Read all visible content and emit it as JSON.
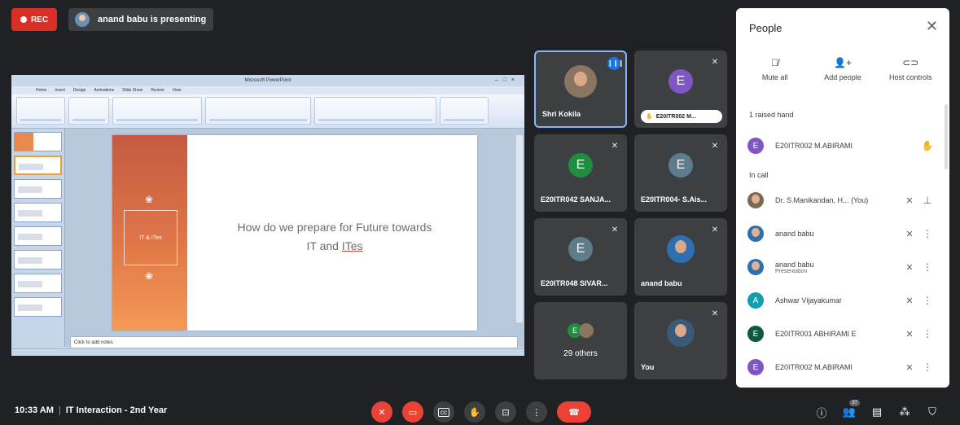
{
  "recording": {
    "label": "REC"
  },
  "presenter": {
    "text": "anand babu is presenting"
  },
  "powerpoint": {
    "window_title": "Microsoft PowerPoint",
    "tabs": [
      "Home",
      "Insert",
      "Design",
      "Animations",
      "Slide Show",
      "Review",
      "View"
    ],
    "slide_badge": "IT & ITes",
    "slide_title_line1": "How do we prepare for Future towards",
    "slide_title_line2_a": "IT and ",
    "slide_title_line2_b": "ITes",
    "notes_placeholder": "Click to add notes"
  },
  "tiles": [
    {
      "name": "Shri Kokila",
      "speaking": true
    },
    {
      "initial": "E",
      "name": "E20ITR002 M...",
      "raised_hand": true
    },
    {
      "initial": "E",
      "name": "E20ITR042 SANJA..."
    },
    {
      "initial": "E",
      "name": "E20ITR004- S.Ais..."
    },
    {
      "initial": "E",
      "name": "E20ITR048 SIVAR..."
    },
    {
      "name": "anand babu"
    },
    {
      "initial": "E",
      "label": "29 others"
    },
    {
      "name": "You"
    }
  ],
  "people_panel": {
    "title": "People",
    "actions": [
      {
        "label": "Mute all",
        "icon": "mic-off-icon"
      },
      {
        "label": "Add people",
        "icon": "add-person-icon"
      },
      {
        "label": "Host controls",
        "icon": "toggle-icon"
      }
    ],
    "raised_section": "1 raised hand",
    "raised": [
      {
        "initial": "E",
        "name": "E20ITR002 M.ABIRAMI"
      }
    ],
    "in_call_section": "In call",
    "people": [
      {
        "name": "Dr. S.Manikandan, H...",
        "suffix": "(You)"
      },
      {
        "name": "anand babu"
      },
      {
        "name": "anand babu",
        "sub": "Presentation"
      },
      {
        "initial": "A",
        "name": "Ashwar Vijayakumar"
      },
      {
        "initial": "E",
        "name": "E20ITR001 ABHIRAMI E"
      },
      {
        "initial": "E",
        "name": "E20ITR002 M.ABIRAMI"
      }
    ]
  },
  "bottom_bar": {
    "time": "10:33 AM",
    "meeting_name": "IT Interaction - 2nd Year",
    "participants_count": "37"
  }
}
